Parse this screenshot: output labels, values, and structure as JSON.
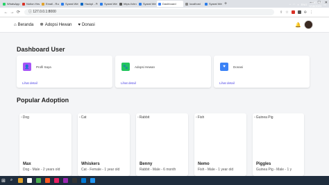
{
  "browser": {
    "tabs": [
      {
        "label": "WhatsApp",
        "color": "#25d366"
      },
      {
        "label": "Notion Hewan",
        "color": "#d93025"
      },
      {
        "label": "Email - Rum",
        "color": "#e1a12a"
      },
      {
        "label": "Syarat Webs",
        "color": "#2b7de9"
      },
      {
        "label": "Hackpl - Proj",
        "color": "#0a66c2"
      },
      {
        "label": "Syarat Webs",
        "color": "#2b7de9"
      },
      {
        "label": "https://chro",
        "color": "#555555"
      },
      {
        "label": "Syarat Webs",
        "color": "#2b7de9"
      },
      {
        "label": "Dashboard",
        "color": "#3b82f6",
        "active": true
      },
      {
        "label": "localhost",
        "color": "#888888"
      },
      {
        "label": "Syarat Webs",
        "color": "#2b7de9"
      }
    ],
    "new_tab": "+",
    "url": "127.0.0.1:8000"
  },
  "nav": {
    "items": [
      {
        "label": "Beranda",
        "icon": "home-icon"
      },
      {
        "label": "Adopsi Hewan",
        "icon": "paw-icon"
      },
      {
        "label": "Donasi",
        "icon": "donate-icon"
      }
    ]
  },
  "dashboard": {
    "title": "Dashboard User",
    "cards": [
      {
        "label": "Profil Saya",
        "link": "Lihat detail",
        "color": "#a855f7",
        "icon": "user-icon"
      },
      {
        "label": "Adopsi Hewan",
        "link": "Lihat detail",
        "color": "#22c55e",
        "icon": "paw-icon"
      },
      {
        "label": "Donasi",
        "link": "Lihat detail",
        "color": "#3b82f6",
        "icon": "donate-icon"
      }
    ]
  },
  "popular": {
    "title": "Popular Adoption",
    "pets": [
      {
        "alt": "Dog",
        "name": "Max",
        "info": "Dog - Male - 2 years old"
      },
      {
        "alt": "Cat",
        "name": "Whiskers",
        "info": "Cat - Female - 1 year old"
      },
      {
        "alt": "Rabbit",
        "name": "Benny",
        "info": "Rabbit - Male - 6 month"
      },
      {
        "alt": "Fish",
        "name": "Nemo",
        "info": "Fish - Male - 1 year old"
      },
      {
        "alt": "Guinea Pig",
        "name": "Piggles",
        "info": "Guinea Pig - Male - 1 y"
      }
    ]
  },
  "taskbar": {
    "apps": [
      {
        "color": "#e1a12a"
      },
      {
        "color": "#ffffff"
      },
      {
        "color": "#4caf50"
      },
      {
        "color": "#ff5722"
      },
      {
        "color": "#e91e63"
      },
      {
        "color": "#9c27b0"
      },
      {
        "color": "#333333"
      },
      {
        "color": "#0078d4"
      },
      {
        "color": "#2196f3"
      }
    ],
    "lang": "ENG",
    "time": "9:47 AM",
    "date": "9/18/2023"
  }
}
